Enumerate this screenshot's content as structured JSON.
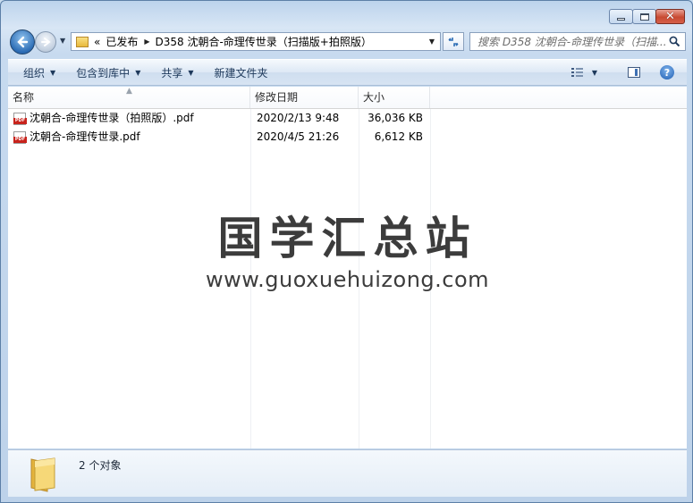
{
  "address": {
    "overflow": "«",
    "crumbs": [
      "已发布",
      "D358 沈朝合-命理传世录（扫描版+拍照版）"
    ]
  },
  "search": {
    "placeholder": "搜索 D358 沈朝合-命理传世录（扫描..."
  },
  "toolbar": {
    "organize": "组织",
    "include_in_library": "包含到库中",
    "share": "共享",
    "new_folder": "新建文件夹"
  },
  "columns": {
    "name": "名称",
    "date": "修改日期",
    "size": "大小"
  },
  "files": [
    {
      "name": "沈朝合-命理传世录（拍照版）.pdf",
      "date": "2020/2/13 9:48",
      "size": "36,036 KB",
      "icon": "pdf-icon"
    },
    {
      "name": "沈朝合-命理传世录.pdf",
      "date": "2020/4/5 21:26",
      "size": "6,612 KB",
      "icon": "pdf-icon"
    }
  ],
  "watermark": {
    "title": "国学汇总站",
    "url": "www.guoxuehuizong.com"
  },
  "status": {
    "count_text": "2 个对象"
  },
  "colors": {
    "pdf_red": "#c8231c",
    "folder_yellow": "#f3cf5c",
    "accent": "#2d6db5"
  }
}
